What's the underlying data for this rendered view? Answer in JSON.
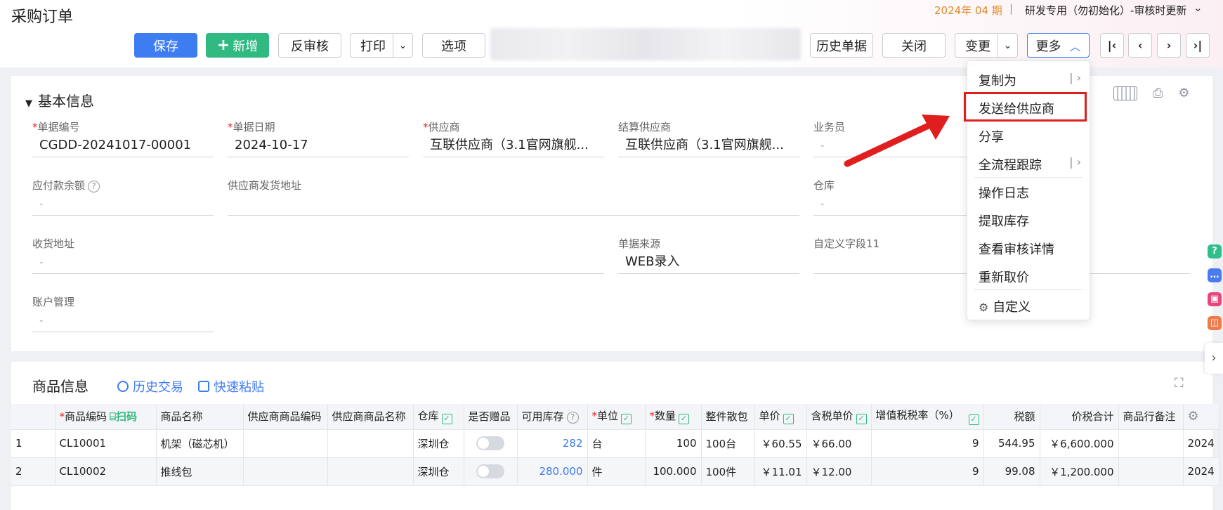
{
  "header": {
    "title": "采购订单",
    "period": "2024年 04 期",
    "period_sep": "|",
    "org": "研发专用（勿初始化）-审核时更新"
  },
  "toolbar": {
    "save": "保存",
    "add": "新增",
    "unaudit": "反审核",
    "print": "打印",
    "options": "选项",
    "history": "历史单据",
    "close": "关闭",
    "change": "变更",
    "more": "更多"
  },
  "basic": {
    "title": "基本信息",
    "fields": {
      "order_no": {
        "label": "单据编号",
        "value": "CGDD-20241017-00001"
      },
      "order_date": {
        "label": "单据日期",
        "value": "2024-10-17"
      },
      "supplier": {
        "label": "供应商",
        "value": "互联供应商（3.1官网旗舰..."
      },
      "settle_supplier": {
        "label": "结算供应商",
        "value": "互联供应商（3.1官网旗舰..."
      },
      "salesman": {
        "label": "业务员",
        "value": "-"
      },
      "payable_balance": {
        "label": "应付款余额",
        "value": "-"
      },
      "supplier_address": {
        "label": "供应商发货地址",
        "value": ""
      },
      "warehouse": {
        "label": "仓库",
        "value": "-"
      },
      "receive_address": {
        "label": "收货地址",
        "value": "-"
      },
      "source": {
        "label": "单据来源",
        "value": "WEB录入"
      },
      "custom11": {
        "label": "自定义字段11",
        "value": ""
      },
      "account": {
        "label": "账户管理",
        "value": "-"
      }
    }
  },
  "goods": {
    "title": "商品信息",
    "history_link": "历史交易",
    "paste_link": "快速粘贴",
    "scan": "扫码",
    "columns": [
      "商品编码",
      "商品名称",
      "供应商商品编码",
      "供应商商品名称",
      "仓库",
      "是否赠品",
      "可用库存",
      "单位",
      "数量",
      "整件散包",
      "单价",
      "含税单价",
      "增值税税率（%）",
      "税额",
      "价税合计",
      "商品行备注"
    ],
    "rows": [
      {
        "idx": "1",
        "code": "CL10001",
        "name": "机架（磁芯机）",
        "sup_code": "",
        "sup_name": "",
        "warehouse": "深圳仓",
        "stock": "282",
        "unit": "台",
        "qty": "100",
        "pack": "100台",
        "price": "￥60.55",
        "tax_price": "￥66.00",
        "tax_rate": "9",
        "tax": "544.95",
        "total": "￥6,600.000",
        "remark": "",
        "date": "2024"
      },
      {
        "idx": "2",
        "code": "CL10002",
        "name": "推线包",
        "sup_code": "",
        "sup_name": "",
        "warehouse": "深圳仓",
        "stock": "280.000",
        "unit": "件",
        "qty": "100.000",
        "pack": "100件",
        "price": "￥11.01",
        "tax_price": "￥12.00",
        "tax_rate": "9",
        "tax": "99.08",
        "total": "￥1,200.000",
        "remark": "",
        "date": "2024"
      }
    ]
  },
  "more_menu": {
    "items": [
      "复制为",
      "发送给供应商",
      "分享",
      "全流程跟踪",
      "操作日志",
      "提取库存",
      "查看审核详情",
      "重新取价",
      "自定义"
    ],
    "sub_sep": "|"
  },
  "colors": {
    "primary": "#3e7cf2",
    "green": "#30b981",
    "highlight": "#e01e1e",
    "period": "#e08a2d"
  }
}
